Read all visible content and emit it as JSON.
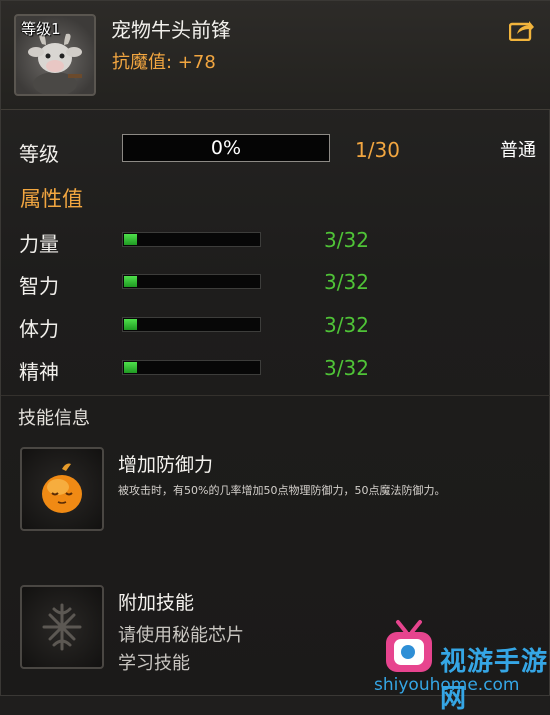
{
  "pet": {
    "level_badge": "等级1",
    "name": "宠物牛头前锋",
    "stat_line": "抗魔值: +78"
  },
  "level": {
    "label": "等级",
    "progress_text": "0%",
    "progress_fraction": 0.0,
    "count": "1/30",
    "quality": "普通"
  },
  "attributes": {
    "title": "属性值",
    "items": [
      {
        "label": "力量",
        "value": "3/32",
        "fraction": 0.09375
      },
      {
        "label": "智力",
        "value": "3/32",
        "fraction": 0.09375
      },
      {
        "label": "体力",
        "value": "3/32",
        "fraction": 0.09375
      },
      {
        "label": "精神",
        "value": "3/32",
        "fraction": 0.09375
      }
    ]
  },
  "skills": {
    "title": "技能信息",
    "items": [
      {
        "name": "增加防御力",
        "description": "被攻击时，有50%的几率增加50点物理防御力，50点魔法防御力。"
      }
    ],
    "extra": {
      "name": "附加技能",
      "line1": "请使用秘能芯片",
      "line2": "学习技能"
    }
  },
  "watermark": {
    "text": "视游手游网",
    "url": "shiyouhome.com"
  },
  "colors": {
    "accent": "#f2a640",
    "attribute_green": "#4fc337",
    "watermark_blue": "#35a6e5"
  },
  "icons": [
    "pet-portrait",
    "share-icon",
    "defense-skill-icon",
    "locked-skill-icon",
    "tv-logo-icon"
  ]
}
